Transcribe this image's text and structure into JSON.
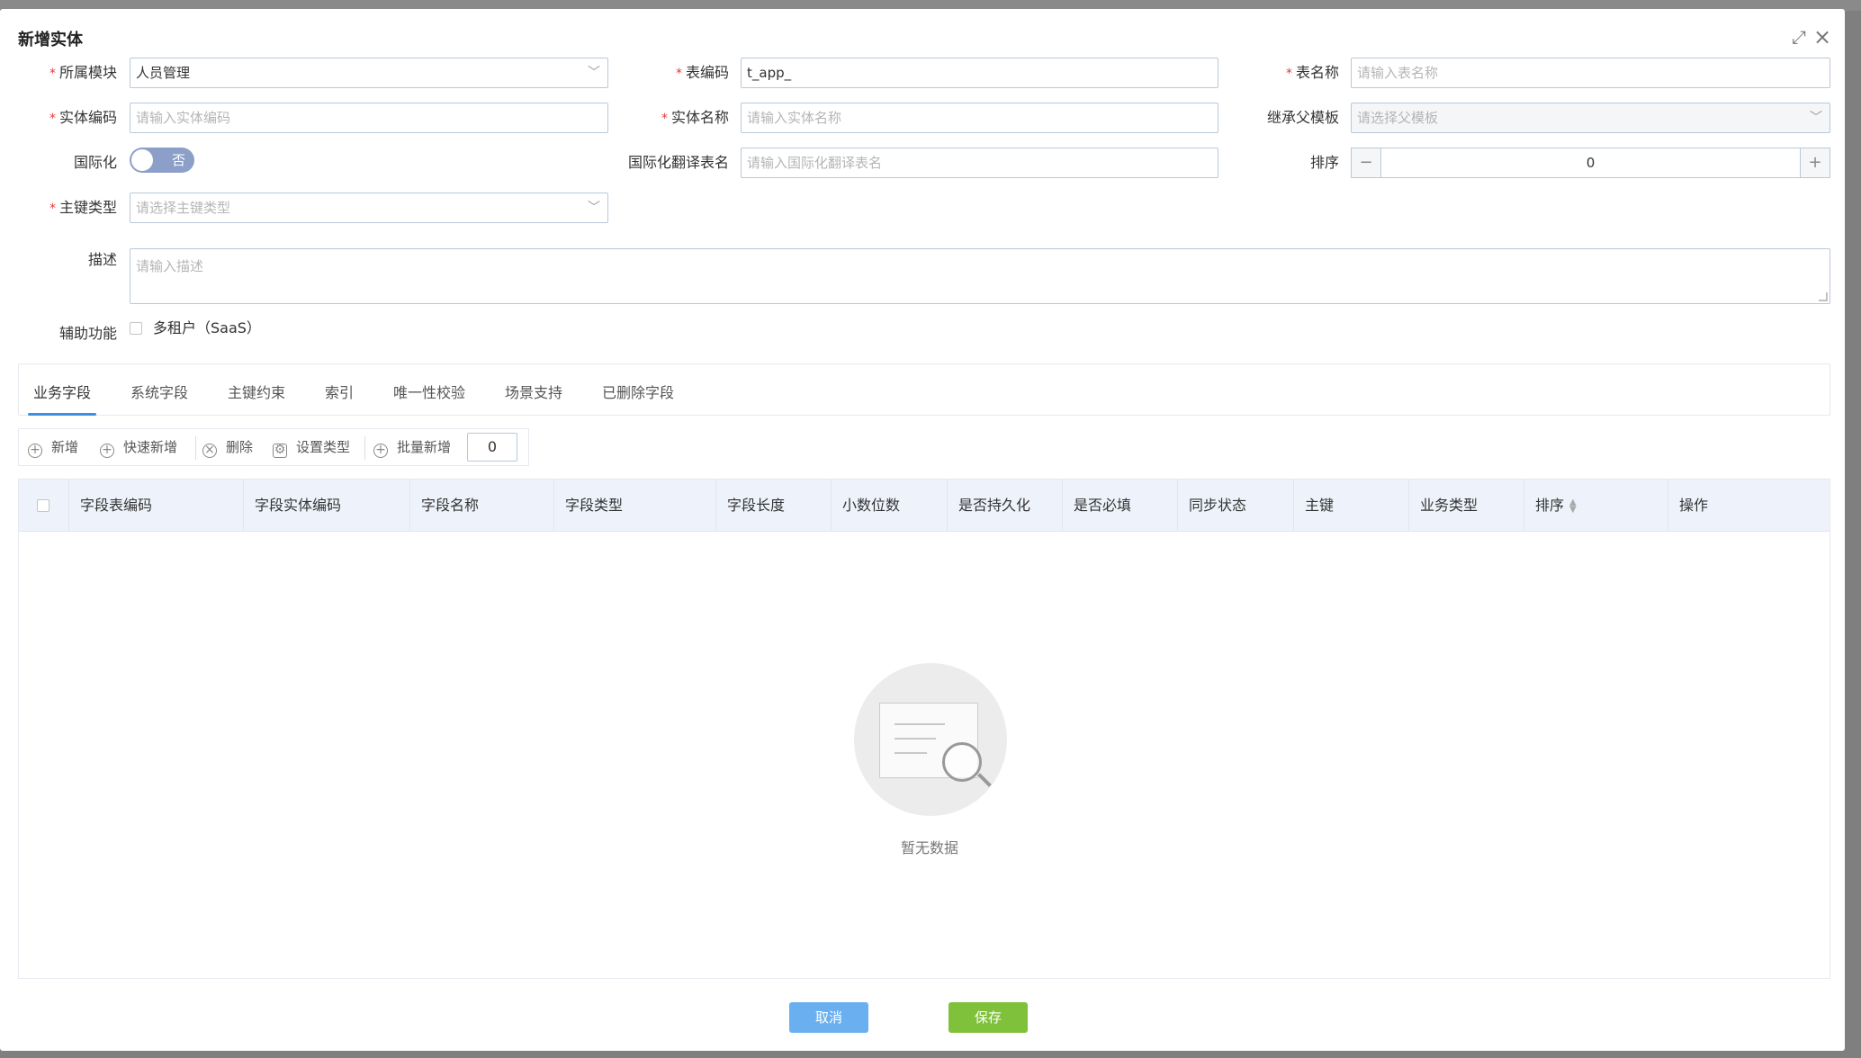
{
  "modal": {
    "title": "新增实体",
    "expand_icon": "⤢",
    "close_icon": "×"
  },
  "form": {
    "module": {
      "label": "所属模块",
      "value": "人员管理"
    },
    "table_code": {
      "label": "表编码",
      "value": "t_app_"
    },
    "table_name": {
      "label": "表名称",
      "placeholder": "请输入表名称"
    },
    "entity_code": {
      "label": "实体编码",
      "placeholder": "请输入实体编码"
    },
    "entity_name": {
      "label": "实体名称",
      "placeholder": "请输入实体名称"
    },
    "parent_template": {
      "label": "继承父模板",
      "placeholder": "请选择父模板"
    },
    "i18n": {
      "label": "国际化",
      "toggle_text": "否"
    },
    "i18n_table": {
      "label": "国际化翻译表名",
      "placeholder": "请输入国际化翻译表名"
    },
    "sort": {
      "label": "排序",
      "value": "0",
      "minus": "−",
      "plus": "+"
    },
    "pk_type": {
      "label": "主键类型",
      "placeholder": "请选择主键类型"
    },
    "description": {
      "label": "描述",
      "placeholder": "请输入描述"
    },
    "aux": {
      "label": "辅助功能",
      "multi_tenant": "多租户（SaaS）"
    }
  },
  "tabs": [
    {
      "label": "业务字段"
    },
    {
      "label": "系统字段"
    },
    {
      "label": "主键约束"
    },
    {
      "label": "索引"
    },
    {
      "label": "唯一性校验"
    },
    {
      "label": "场景支持"
    },
    {
      "label": "已删除字段"
    }
  ],
  "toolbar": {
    "add": "新增",
    "quick_add": "快速新增",
    "delete": "删除",
    "set_type": "设置类型",
    "batch_add": "批量新增",
    "batch_count": "0"
  },
  "table": {
    "columns": [
      "字段表编码",
      "字段实体编码",
      "字段名称",
      "字段类型",
      "字段长度",
      "小数位数",
      "是否持久化",
      "是否必填",
      "同步状态",
      "主键",
      "业务类型",
      "排序",
      "操作"
    ],
    "empty_text": "暂无数据"
  },
  "footer": {
    "cancel": "取消",
    "save": "保存"
  },
  "colors": {
    "accent": "#3d8fe6",
    "cancel_button": "#6ab0f0",
    "save_button": "#7fc13a",
    "required": "#e4393c"
  }
}
